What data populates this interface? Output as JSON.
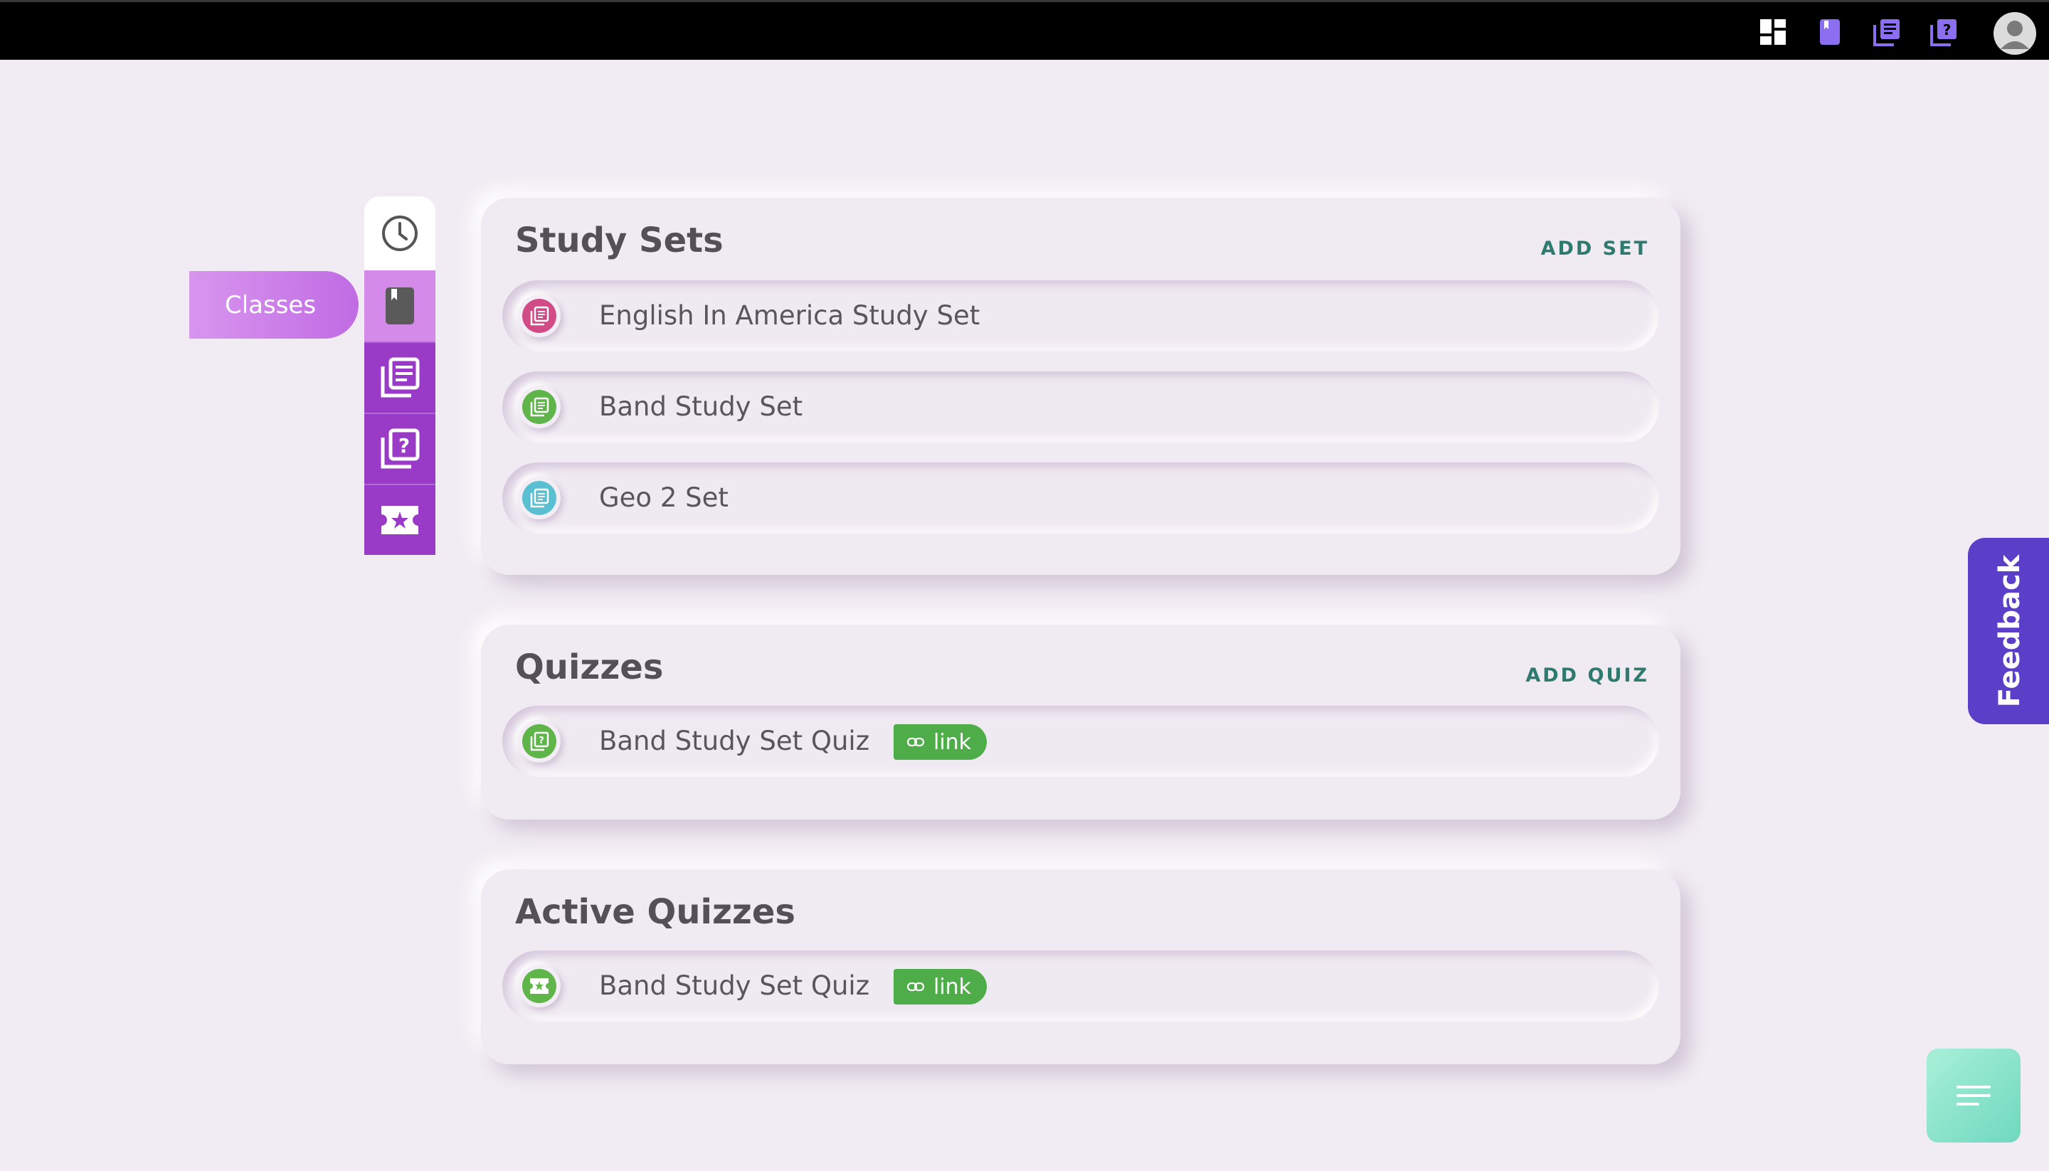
{
  "topbar": {
    "icons": [
      "dashboard-icon",
      "class-book-icon",
      "study-set-icon",
      "quiz-icon",
      "profile-avatar-icon"
    ]
  },
  "sidebar": {
    "active_label": "Classes",
    "items": [
      {
        "name": "history",
        "icon": "clock-icon"
      },
      {
        "name": "classes",
        "icon": "bookmark-book-icon"
      },
      {
        "name": "study-sets",
        "icon": "study-set-icon"
      },
      {
        "name": "quizzes",
        "icon": "quiz-icon"
      },
      {
        "name": "active-quizzes",
        "icon": "ticket-star-icon"
      }
    ]
  },
  "study_sets": {
    "title": "Study Sets",
    "action": "ADD SET",
    "items": [
      {
        "label": "English In America Study Set",
        "color": "#d14b86"
      },
      {
        "label": "Band Study Set",
        "color": "#5fb54a"
      },
      {
        "label": "Geo 2 Set",
        "color": "#5bbfd2"
      }
    ]
  },
  "quizzes": {
    "title": "Quizzes",
    "action": "ADD QUIZ",
    "items": [
      {
        "label": "Band Study Set Quiz",
        "badge": "link",
        "color": "#5fb54a"
      }
    ]
  },
  "active_quizzes": {
    "title": "Active Quizzes",
    "items": [
      {
        "label": "Band Study Set Quiz",
        "badge": "link",
        "color": "#5fb54a"
      }
    ]
  },
  "feedback": {
    "label": "Feedback"
  },
  "colors": {
    "accent_purple": "#9a3bc7",
    "tab_pink": "#d48ae8",
    "link_green": "#4ead48",
    "feedback_blue": "#5b3fc9",
    "action_teal": "#2f7a6e"
  }
}
